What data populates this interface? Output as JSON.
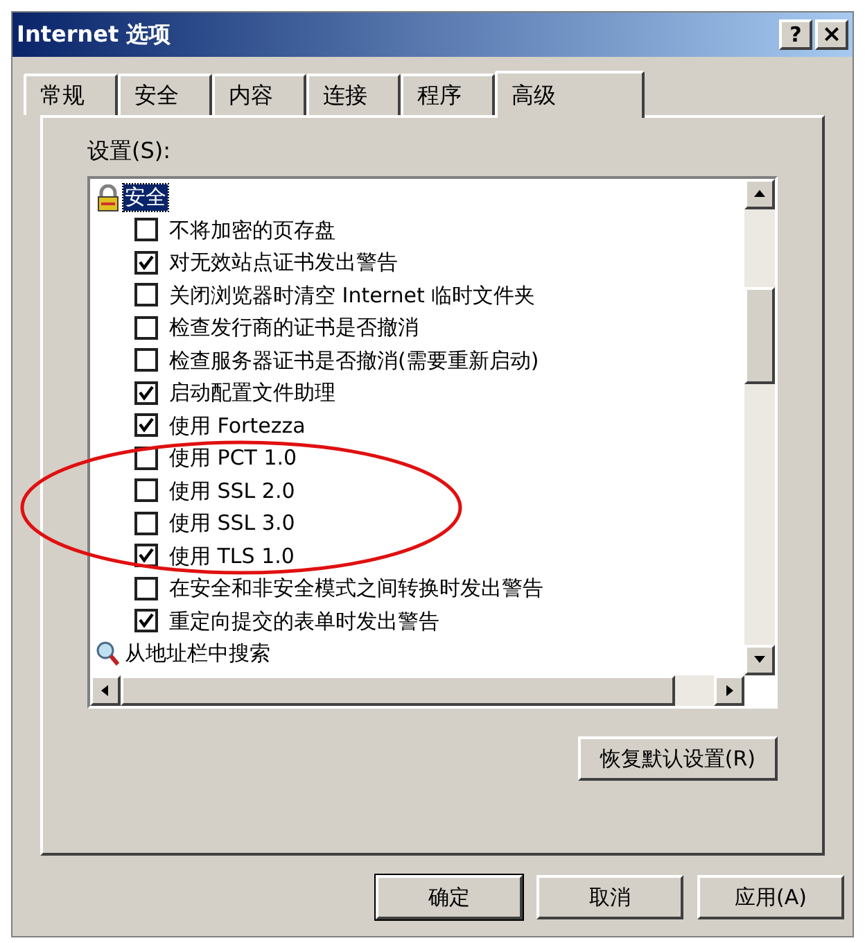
{
  "window": {
    "title": "Internet 选项",
    "help": "?",
    "close": "×"
  },
  "tabs": [
    {
      "label": "常规",
      "selected": false
    },
    {
      "label": "安全",
      "selected": false
    },
    {
      "label": "内容",
      "selected": false
    },
    {
      "label": "连接",
      "selected": false
    },
    {
      "label": "程序",
      "selected": false
    },
    {
      "label": "高级",
      "selected": true
    }
  ],
  "settings_label": "设置(S):",
  "settings": [
    {
      "kind": "security",
      "label": "安全",
      "selected": true,
      "children": [
        {
          "label": "不将加密的页存盘",
          "checked": false
        },
        {
          "label": "对无效站点证书发出警告",
          "checked": true
        },
        {
          "label": "关闭浏览器时清空 Internet 临时文件夹",
          "checked": false
        },
        {
          "label": "检查发行商的证书是否撤消",
          "checked": false
        },
        {
          "label": "检查服务器证书是否撤消(需要重新启动)",
          "checked": false
        },
        {
          "label": "启动配置文件助理",
          "checked": true
        },
        {
          "label": "使用 Fortezza",
          "checked": true
        },
        {
          "label": "使用 PCT 1.0",
          "checked": false
        },
        {
          "label": "使用 SSL 2.0",
          "checked": false
        },
        {
          "label": "使用 SSL 3.0",
          "checked": false
        },
        {
          "label": "使用 TLS 1.0",
          "checked": true
        },
        {
          "label": "在安全和非安全模式之间转换时发出警告",
          "checked": false
        },
        {
          "label": "重定向提交的表单时发出警告",
          "checked": true
        }
      ]
    },
    {
      "kind": "search",
      "label": "从地址栏中搜索",
      "selected": false
    }
  ],
  "restore_button": "恢复默认设置(R)",
  "buttons": [
    {
      "label": "确定",
      "default": true
    },
    {
      "label": "取消",
      "default": false
    },
    {
      "label": "应用(A)",
      "default": false
    }
  ]
}
